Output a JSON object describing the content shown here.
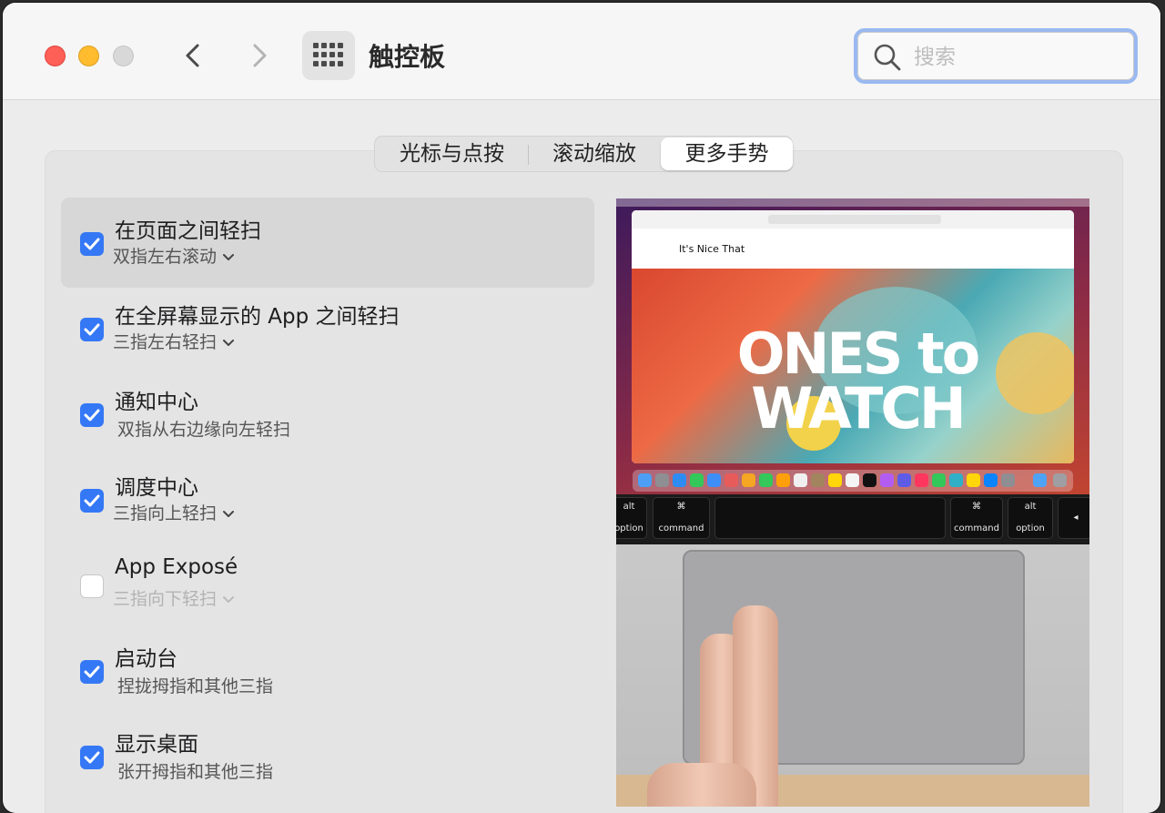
{
  "window": {
    "title": "触控板",
    "search": {
      "placeholder": "搜索",
      "value": ""
    }
  },
  "tabs": [
    {
      "label": "光标与点按",
      "active": false
    },
    {
      "label": "滚动缩放",
      "active": false
    },
    {
      "label": "更多手势",
      "active": true
    }
  ],
  "gestures": [
    {
      "title": "在页面之间轻扫",
      "subtitle": "双指左右滚动",
      "checked": true,
      "has_popup": true,
      "selected": true
    },
    {
      "title": "在全屏幕显示的 App 之间轻扫",
      "subtitle": "三指左右轻扫",
      "checked": true,
      "has_popup": true,
      "selected": false
    },
    {
      "title": "通知中心",
      "subtitle": "双指从右边缘向左轻扫",
      "checked": true,
      "has_popup": false,
      "selected": false
    },
    {
      "title": "调度中心",
      "subtitle": "三指向上轻扫",
      "checked": true,
      "has_popup": true,
      "selected": false
    },
    {
      "title": "App Exposé",
      "subtitle": "三指向下轻扫",
      "checked": false,
      "has_popup": true,
      "selected": false
    },
    {
      "title": "启动台",
      "subtitle": "捏拢拇指和其他三指",
      "checked": true,
      "has_popup": false,
      "selected": false
    },
    {
      "title": "显示桌面",
      "subtitle": "张开拇指和其他三指",
      "checked": true,
      "has_popup": false,
      "selected": false
    }
  ],
  "preview": {
    "site_name": "It's Nice That",
    "hero_line1": "ONES to",
    "hero_line2": "WATCH",
    "keys": {
      "left_alt_top": "alt",
      "left_alt_bottom": "option",
      "left_cmd_top": "⌘",
      "left_cmd_bottom": "command",
      "right_cmd_top": "⌘",
      "right_cmd_bottom": "command",
      "right_alt_top": "alt",
      "right_alt_bottom": "option",
      "arrow": "◂"
    }
  },
  "colors": {
    "accent": "#3478f6",
    "close": "#fe5f57",
    "minimize": "#febc2e",
    "zoom_inactive": "#d8d8d8",
    "search_focus_ring": "#9ab9f0"
  }
}
